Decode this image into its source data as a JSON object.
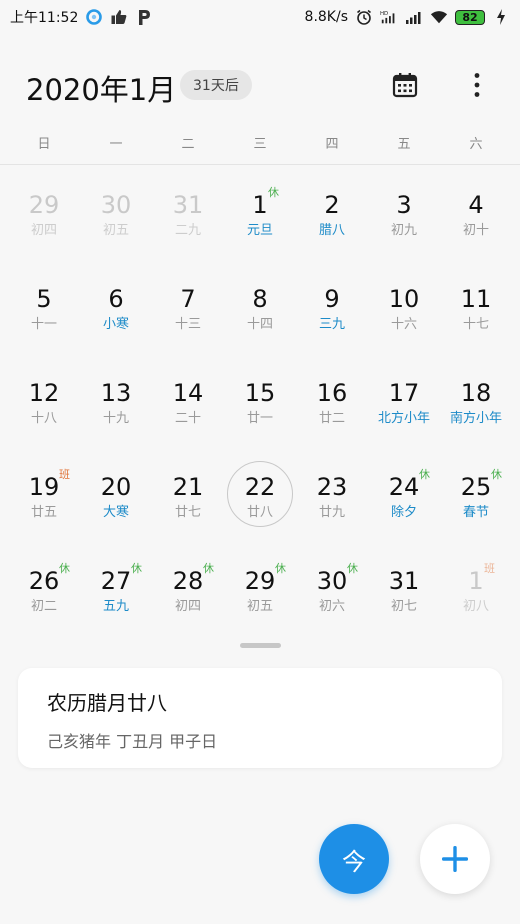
{
  "status_bar": {
    "time": "上午11:52",
    "speed": "8.8K/s",
    "battery": "82",
    "icons": [
      "qq-browser-icon",
      "thumbs-up-icon",
      "parking-icon",
      "alarm-icon",
      "hd-signal-icon",
      "signal-icon",
      "wifi-icon",
      "battery-icon",
      "charging-icon"
    ]
  },
  "header": {
    "title": "2020年1月",
    "countdown": "31天后",
    "calendar_icon": "calendar-icon",
    "more_icon": "more-vertical-icon"
  },
  "weekdays": [
    "日",
    "一",
    "二",
    "三",
    "四",
    "五",
    "六"
  ],
  "weeks": [
    [
      {
        "day": "29",
        "lunar": "初四",
        "outside": true
      },
      {
        "day": "30",
        "lunar": "初五",
        "outside": true
      },
      {
        "day": "31",
        "lunar": "二九",
        "outside": true
      },
      {
        "day": "1",
        "lunar": "元旦",
        "festival": true,
        "badge": "休",
        "badge_type": "rest"
      },
      {
        "day": "2",
        "lunar": "腊八",
        "festival": true
      },
      {
        "day": "3",
        "lunar": "初九"
      },
      {
        "day": "4",
        "lunar": "初十"
      }
    ],
    [
      {
        "day": "5",
        "lunar": "十一"
      },
      {
        "day": "6",
        "lunar": "小寒",
        "festival": true
      },
      {
        "day": "7",
        "lunar": "十三"
      },
      {
        "day": "8",
        "lunar": "十四"
      },
      {
        "day": "9",
        "lunar": "三九",
        "festival": true
      },
      {
        "day": "10",
        "lunar": "十六"
      },
      {
        "day": "11",
        "lunar": "十七"
      }
    ],
    [
      {
        "day": "12",
        "lunar": "十八"
      },
      {
        "day": "13",
        "lunar": "十九"
      },
      {
        "day": "14",
        "lunar": "二十"
      },
      {
        "day": "15",
        "lunar": "廿一"
      },
      {
        "day": "16",
        "lunar": "廿二"
      },
      {
        "day": "17",
        "lunar": "北方小年",
        "festival": true
      },
      {
        "day": "18",
        "lunar": "南方小年",
        "festival": true
      }
    ],
    [
      {
        "day": "19",
        "lunar": "廿五",
        "badge": "班",
        "badge_type": "work"
      },
      {
        "day": "20",
        "lunar": "大寒",
        "festival": true
      },
      {
        "day": "21",
        "lunar": "廿七"
      },
      {
        "day": "22",
        "lunar": "廿八",
        "today": true
      },
      {
        "day": "23",
        "lunar": "廿九"
      },
      {
        "day": "24",
        "lunar": "除夕",
        "festival": true,
        "badge": "休",
        "badge_type": "rest"
      },
      {
        "day": "25",
        "lunar": "春节",
        "festival": true,
        "badge": "休",
        "badge_type": "rest"
      }
    ],
    [
      {
        "day": "26",
        "lunar": "初二",
        "badge": "休",
        "badge_type": "rest"
      },
      {
        "day": "27",
        "lunar": "五九",
        "festival": true,
        "badge": "休",
        "badge_type": "rest"
      },
      {
        "day": "28",
        "lunar": "初四",
        "badge": "休",
        "badge_type": "rest"
      },
      {
        "day": "29",
        "lunar": "初五",
        "badge": "休",
        "badge_type": "rest"
      },
      {
        "day": "30",
        "lunar": "初六",
        "badge": "休",
        "badge_type": "rest"
      },
      {
        "day": "31",
        "lunar": "初七"
      },
      {
        "day": "1",
        "lunar": "初八",
        "outside": true,
        "badge": "班",
        "badge_type": "work"
      }
    ]
  ],
  "lunar_card": {
    "title": "农历腊月廿八",
    "subtitle": "己亥猪年 丁丑月 甲子日"
  },
  "fab": {
    "today_label": "今",
    "add_icon": "plus-icon"
  },
  "colors": {
    "accent": "#1e8fe6",
    "festival": "#1d8bc8",
    "rest_badge": "#4caf50",
    "work_badge": "#e0743a"
  }
}
